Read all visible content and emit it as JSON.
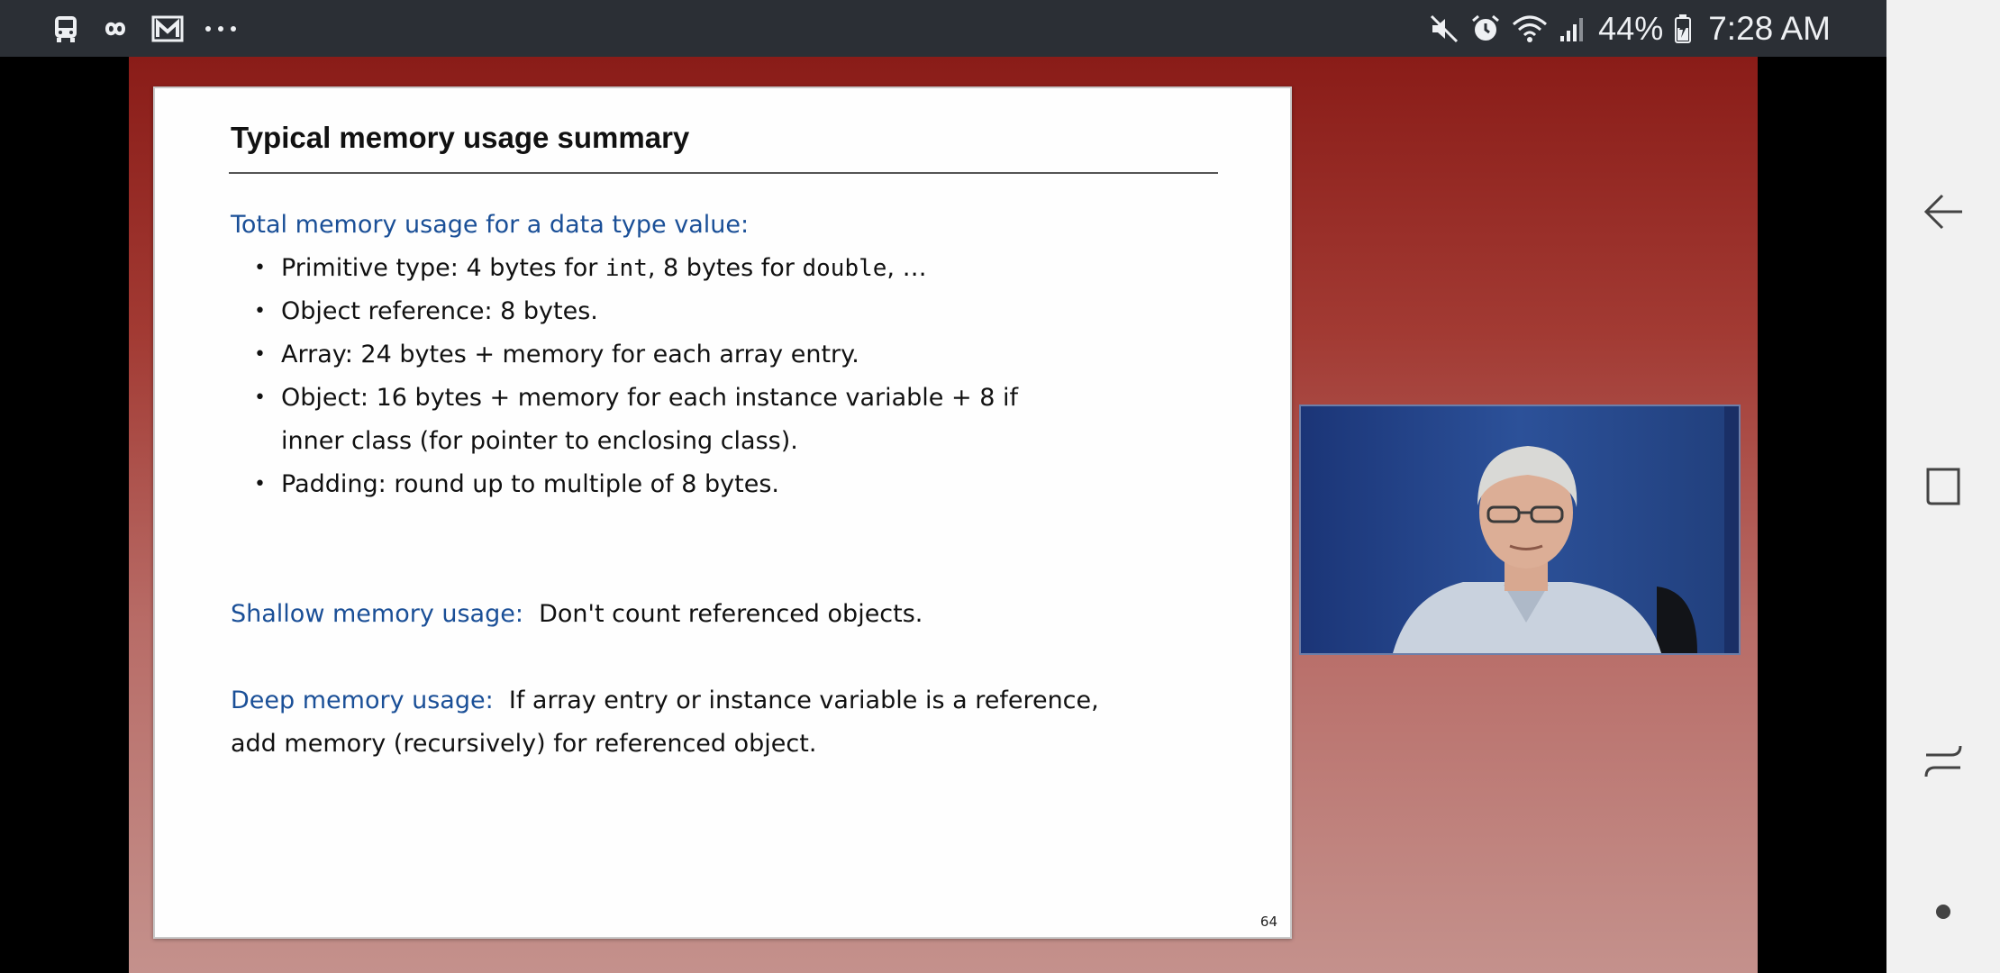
{
  "status_bar": {
    "left_icons": [
      "bus-icon",
      "infinity-icon",
      "mail-icon",
      "more-dots-icon"
    ],
    "right_icons": [
      "mute-icon",
      "alarm-icon",
      "wifi-icon",
      "signal-icon",
      "battery-icon"
    ],
    "battery": "44%",
    "time": "7:28 AM"
  },
  "slide": {
    "title": "Typical memory usage summary",
    "intro": "Total memory usage for a data type value:",
    "bullets": {
      "primitive": {
        "label": "Primitive type:  4 bytes for ",
        "int_word": "int",
        "mid": ", 8 bytes for ",
        "double_word": "double",
        "end": ", …"
      },
      "reference": "Object reference:  8 bytes.",
      "array": "Array:  24 bytes + memory for each array entry.",
      "object_line1": "Object:  16 bytes +  memory for each instance variable + 8 if",
      "object_line2": "inner class (for pointer to enclosing class).",
      "padding": "Padding:  round up to multiple of 8 bytes."
    },
    "shallow": {
      "label": "Shallow memory usage:",
      "text": "  Don't count referenced objects."
    },
    "deep": {
      "label": "Deep memory usage:",
      "text_line1": "  If array entry or instance variable is a reference,",
      "text_line2": "add memory (recursively) for referenced object."
    },
    "page_number": "64"
  },
  "nav_bar": {
    "buttons": [
      "back-icon",
      "recents-icon",
      "switch-icon",
      "dot-icon"
    ]
  },
  "colors": {
    "status_bar_bg": "#2b2f35",
    "slide_accent_blue": "#1a4f97",
    "backdrop_top": "#8a1c18",
    "backdrop_bottom": "#c4918c",
    "nav_bar_bg": "#f1f1f1"
  }
}
